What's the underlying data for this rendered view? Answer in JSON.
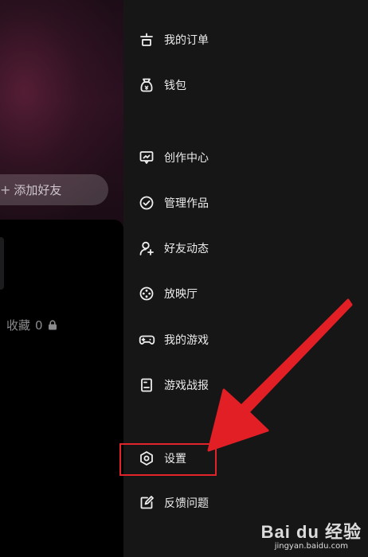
{
  "left": {
    "add_friend_label": "添加好友",
    "collect_label": "收藏",
    "collect_count": "0"
  },
  "menu": [
    {
      "label": "我的订单",
      "icon": "order-icon"
    },
    {
      "label": "钱包",
      "icon": "wallet-icon"
    },
    {
      "label": "创作中心",
      "icon": "creator-center-icon"
    },
    {
      "label": "管理作品",
      "icon": "manage-works-icon"
    },
    {
      "label": "好友动态",
      "icon": "friend-activity-icon"
    },
    {
      "label": "放映厅",
      "icon": "screening-room-icon"
    },
    {
      "label": "我的游戏",
      "icon": "gamepad-icon"
    },
    {
      "label": "游戏战报",
      "icon": "game-report-icon"
    },
    {
      "label": "设置",
      "icon": "settings-icon"
    },
    {
      "label": "反馈问题",
      "icon": "feedback-icon"
    }
  ],
  "annotation": {
    "highlight_color": "#e0242a",
    "highlighted_item": "设置"
  },
  "watermark": {
    "logo_text": "Bai du 经验",
    "sub_text": "jingyan.baidu.com"
  }
}
